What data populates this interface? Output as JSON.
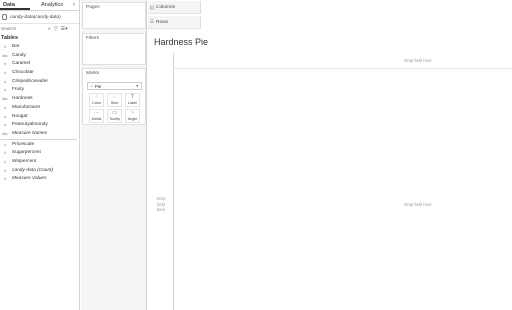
{
  "data_pane": {
    "tabs": [
      {
        "label": "Data",
        "active": true
      },
      {
        "label": "Analytics",
        "active": false
      }
    ],
    "collapse_icon": "chevron-left-icon",
    "datasource": "candy-data(candy-data)",
    "search_placeholder": "Search",
    "tables_heading": "Tables",
    "dimensions": [
      {
        "icon": "#",
        "name": "Bar"
      },
      {
        "icon": "Abc",
        "name": "Candy"
      },
      {
        "icon": "#",
        "name": "Caramel"
      },
      {
        "icon": "#",
        "name": "Chocolate"
      },
      {
        "icon": "#",
        "name": "Crispedricewafer"
      },
      {
        "icon": "#",
        "name": "Fruity"
      },
      {
        "icon": "Abc",
        "name": "Hardness"
      },
      {
        "icon": "#",
        "name": "Manufacturer"
      },
      {
        "icon": "#",
        "name": "Nougat"
      },
      {
        "icon": "#",
        "name": "Peanutyalmondy"
      },
      {
        "icon": "Abc",
        "name": "Measure Names"
      }
    ],
    "measures": [
      {
        "icon": "#",
        "name": "Pricescale"
      },
      {
        "icon": "#",
        "name": "Sugarpercent"
      },
      {
        "icon": "#",
        "name": "Winpercent"
      },
      {
        "icon": "#",
        "name": "candy-data (Count)"
      },
      {
        "icon": "#",
        "name": "Measure Values"
      }
    ]
  },
  "cards": {
    "pages": "Pages",
    "filters": "Filters",
    "marks": "Marks",
    "mark_type": "Pie",
    "mark_buttons": [
      {
        "label": "Color",
        "icon": "color-icon",
        "glyph": "⁘"
      },
      {
        "label": "Size",
        "icon": "size-icon",
        "glyph": "◌"
      },
      {
        "label": "Label",
        "icon": "label-icon",
        "glyph": "T"
      },
      {
        "label": "Detail",
        "icon": "detail-icon",
        "glyph": "⋯"
      },
      {
        "label": "Tooltip",
        "icon": "tooltip-icon",
        "glyph": "▭"
      },
      {
        "label": "Angle",
        "icon": "angle-icon",
        "glyph": "◔"
      }
    ]
  },
  "shelves": {
    "columns": "Columns",
    "rows": "Rows"
  },
  "view": {
    "title": "Hardness Pie",
    "drop_top": "Drop field here",
    "drop_left": "Drop field here",
    "drop_center": "Drop field here"
  }
}
